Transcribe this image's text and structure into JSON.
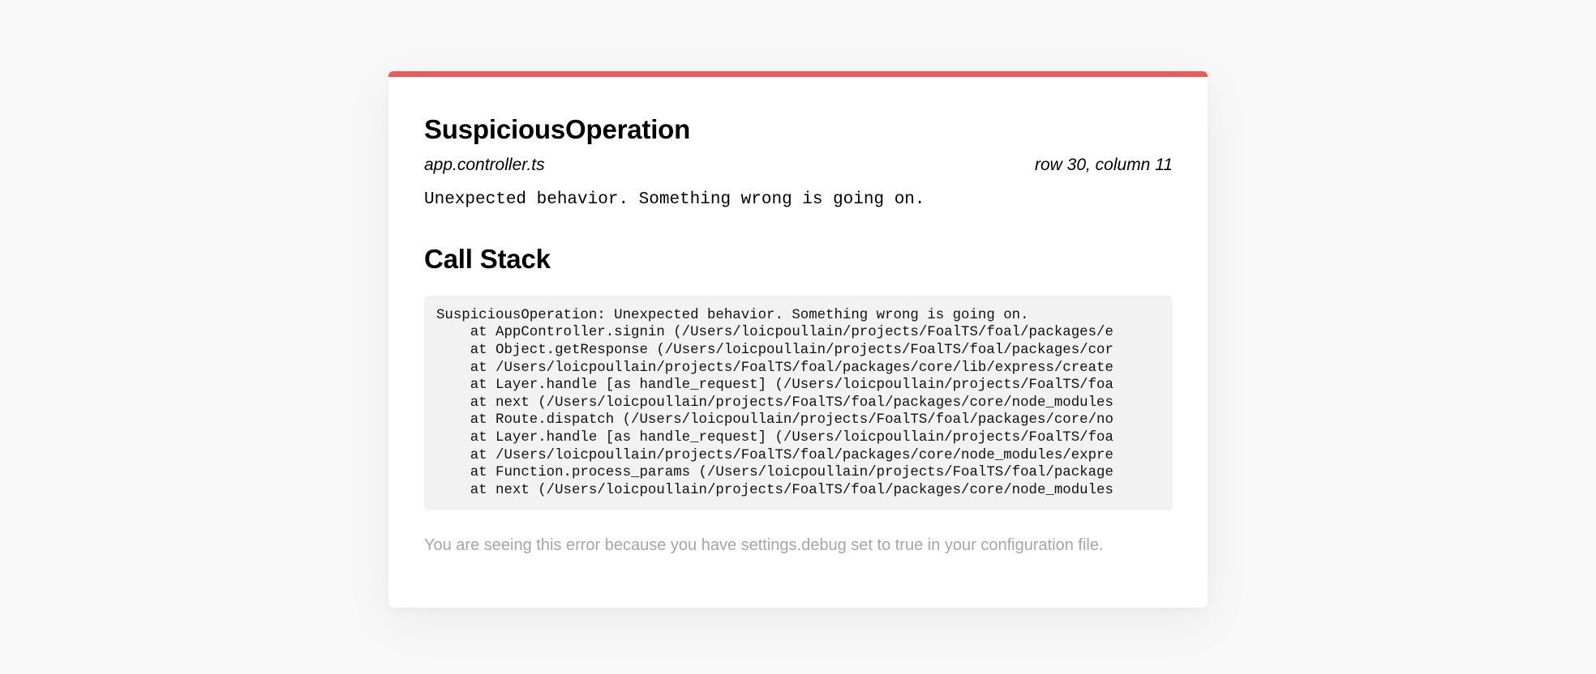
{
  "error": {
    "name": "SuspiciousOperation",
    "file": "app.controller.ts",
    "location": "row 30, column 11",
    "message": "Unexpected behavior. Something wrong is going on."
  },
  "stack": {
    "title": "Call Stack",
    "lines": [
      "SuspiciousOperation: Unexpected behavior. Something wrong is going on.",
      "    at AppController.signin (/Users/loicpoullain/projects/FoalTS/foal/packages/e",
      "    at Object.getResponse (/Users/loicpoullain/projects/FoalTS/foal/packages/cor",
      "    at /Users/loicpoullain/projects/FoalTS/foal/packages/core/lib/express/create",
      "    at Layer.handle [as handle_request] (/Users/loicpoullain/projects/FoalTS/foa",
      "    at next (/Users/loicpoullain/projects/FoalTS/foal/packages/core/node_modules",
      "    at Route.dispatch (/Users/loicpoullain/projects/FoalTS/foal/packages/core/no",
      "    at Layer.handle [as handle_request] (/Users/loicpoullain/projects/FoalTS/foa",
      "    at /Users/loicpoullain/projects/FoalTS/foal/packages/core/node_modules/expre",
      "    at Function.process_params (/Users/loicpoullain/projects/FoalTS/foal/package",
      "    at next (/Users/loicpoullain/projects/FoalTS/foal/packages/core/node_modules"
    ]
  },
  "footer": {
    "text": "You are seeing this error because you have settings.debug set to true in your configuration file."
  },
  "colors": {
    "accent": "#ee5a5a",
    "background": "#f8f8f8",
    "card": "#ffffff",
    "stack_background": "#f2f2f2",
    "footer_text": "#a6a6a6"
  }
}
